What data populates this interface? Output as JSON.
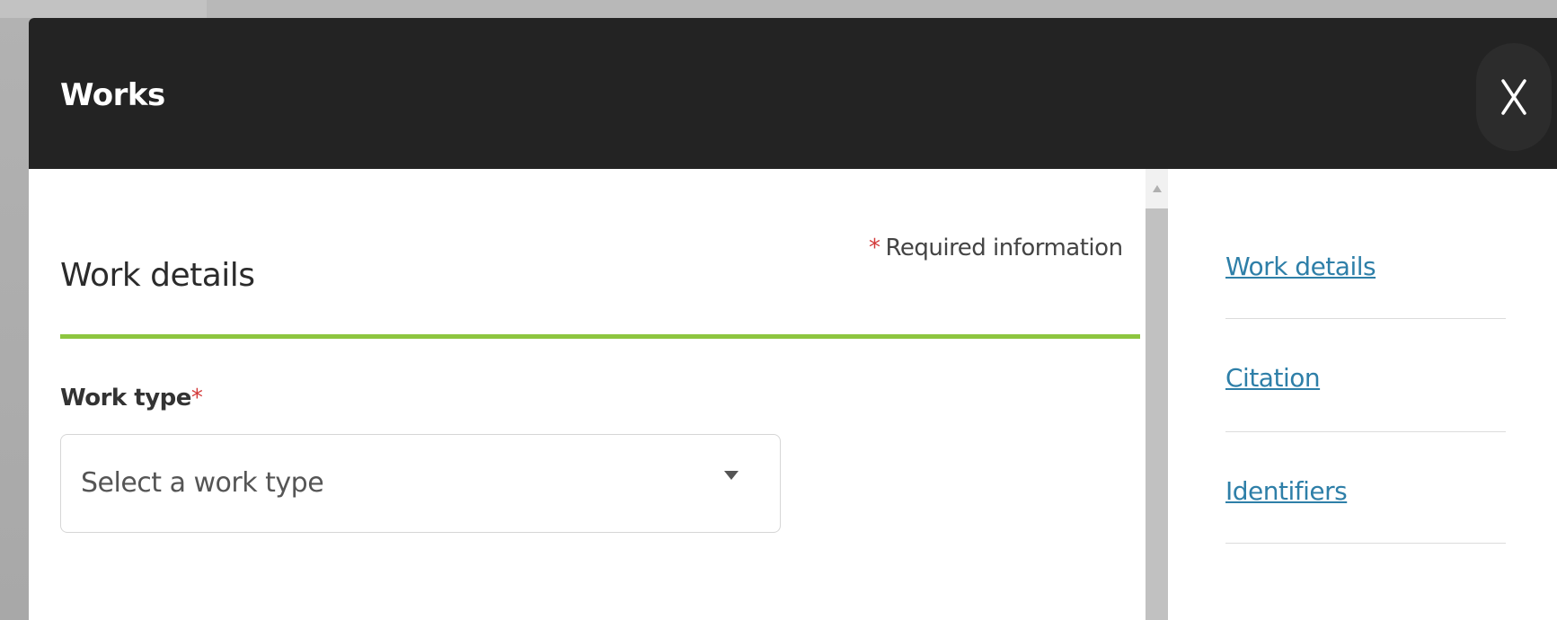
{
  "modal": {
    "title": "Works",
    "close_label": "X"
  },
  "form": {
    "section_title": "Work details",
    "required_note": "Required information",
    "required_marker": "*",
    "work_type": {
      "label": "Work type",
      "required_marker": "*",
      "placeholder": "Select a work type"
    }
  },
  "sidenav": {
    "items": [
      {
        "label": "Work details"
      },
      {
        "label": "Citation"
      },
      {
        "label": "Identifiers"
      }
    ]
  },
  "colors": {
    "header_bg": "#232323",
    "accent_green": "#8dc63f",
    "link_blue": "#2e7fa8",
    "required_red": "#d33a3a"
  }
}
